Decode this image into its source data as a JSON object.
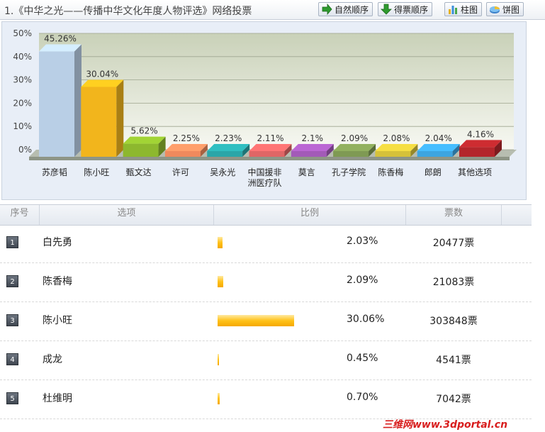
{
  "header": {
    "title": "1.《中华之光——传播中华文化年度人物评选》网络投票",
    "buttons": {
      "natural_order": "自然顺序",
      "vote_order": "得票顺序",
      "bar_chart": "柱图",
      "pie_chart": "饼图"
    }
  },
  "chart_data": {
    "type": "bar",
    "categories": [
      "苏彦韬",
      "陈小旺",
      "甄文达",
      "许可",
      "吴永光",
      "中国援非\n洲医疗队",
      "莫言",
      "孔子学院",
      "陈香梅",
      "郎朗",
      "其他选项"
    ],
    "values": [
      45.26,
      30.04,
      5.62,
      2.25,
      2.23,
      2.11,
      2.1,
      2.09,
      2.08,
      2.04,
      4.16
    ],
    "value_labels": [
      "45.26%",
      "30.04%",
      "5.62%",
      "2.25%",
      "2.23%",
      "2.11%",
      "2.1%",
      "2.09%",
      "2.08%",
      "2.04%",
      "4.16%"
    ],
    "colors": [
      "#b9cfe6",
      "#f2b51c",
      "#8db82e",
      "#f08a5d",
      "#2aa6a8",
      "#e06666",
      "#a35ab8",
      "#7f9a53",
      "#d6c23a",
      "#3da5e0",
      "#b3262b"
    ],
    "yticks": [
      "0%",
      "10%",
      "20%",
      "30%",
      "40%",
      "50%"
    ],
    "ylim": [
      0,
      50
    ],
    "grid": true,
    "title": "",
    "xlabel": "",
    "ylabel": ""
  },
  "table": {
    "columns": [
      "序号",
      "选项",
      "比例",
      "票数"
    ],
    "rows": [
      {
        "rank": "1",
        "name": "白先勇",
        "percent": "2.03%",
        "votes": "20477票",
        "fraction": 0.0203
      },
      {
        "rank": "2",
        "name": "陈香梅",
        "percent": "2.09%",
        "votes": "21083票",
        "fraction": 0.0209
      },
      {
        "rank": "3",
        "name": "陈小旺",
        "percent": "30.06%",
        "votes": "303848票",
        "fraction": 0.3006
      },
      {
        "rank": "4",
        "name": "成龙",
        "percent": "0.45%",
        "votes": "4541票",
        "fraction": 0.0045
      },
      {
        "rank": "5",
        "name": "杜维明",
        "percent": "0.70%",
        "votes": "7042票",
        "fraction": 0.007
      }
    ]
  },
  "watermark": "三维网www.3dportal.cn"
}
